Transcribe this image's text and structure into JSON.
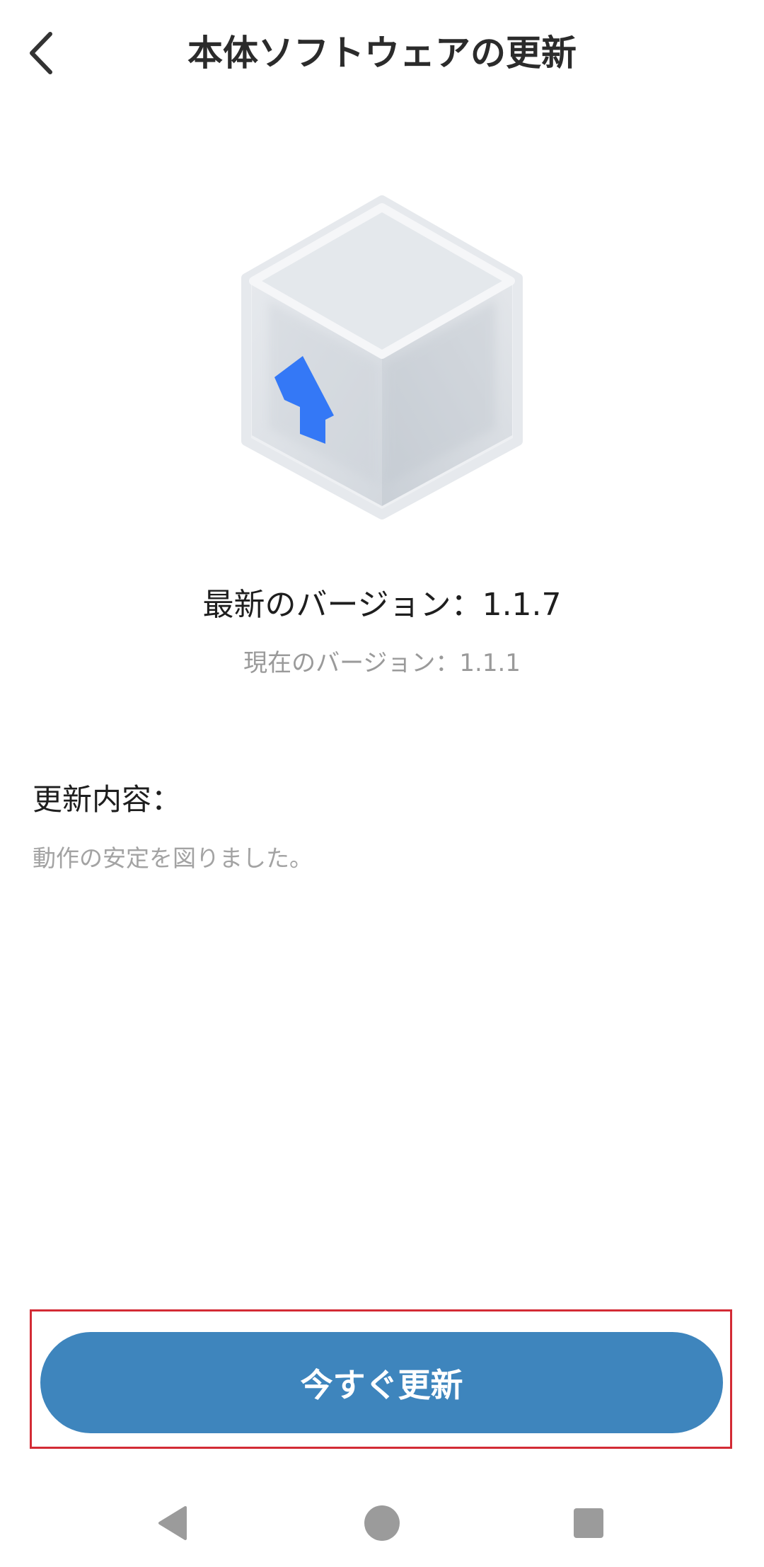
{
  "header": {
    "title": "本体ソフトウェアの更新",
    "back_icon": "chevron-left-icon"
  },
  "hero": {
    "icon": "update-box-icon",
    "arrow_color": "#3478f6"
  },
  "versions": {
    "latest": "最新のバージョン：1.1.7",
    "current": "現在のバージョン：1.1.1"
  },
  "notes": {
    "title": "更新内容：",
    "body": "動作の安定を図りました。"
  },
  "actions": {
    "update_label": "今すぐ更新",
    "button_color": "#3e85bd",
    "highlight_color": "#d32b35"
  },
  "system_nav": {
    "back_icon": "triangle-back-icon",
    "home_icon": "circle-home-icon",
    "recents_icon": "square-recents-icon"
  }
}
